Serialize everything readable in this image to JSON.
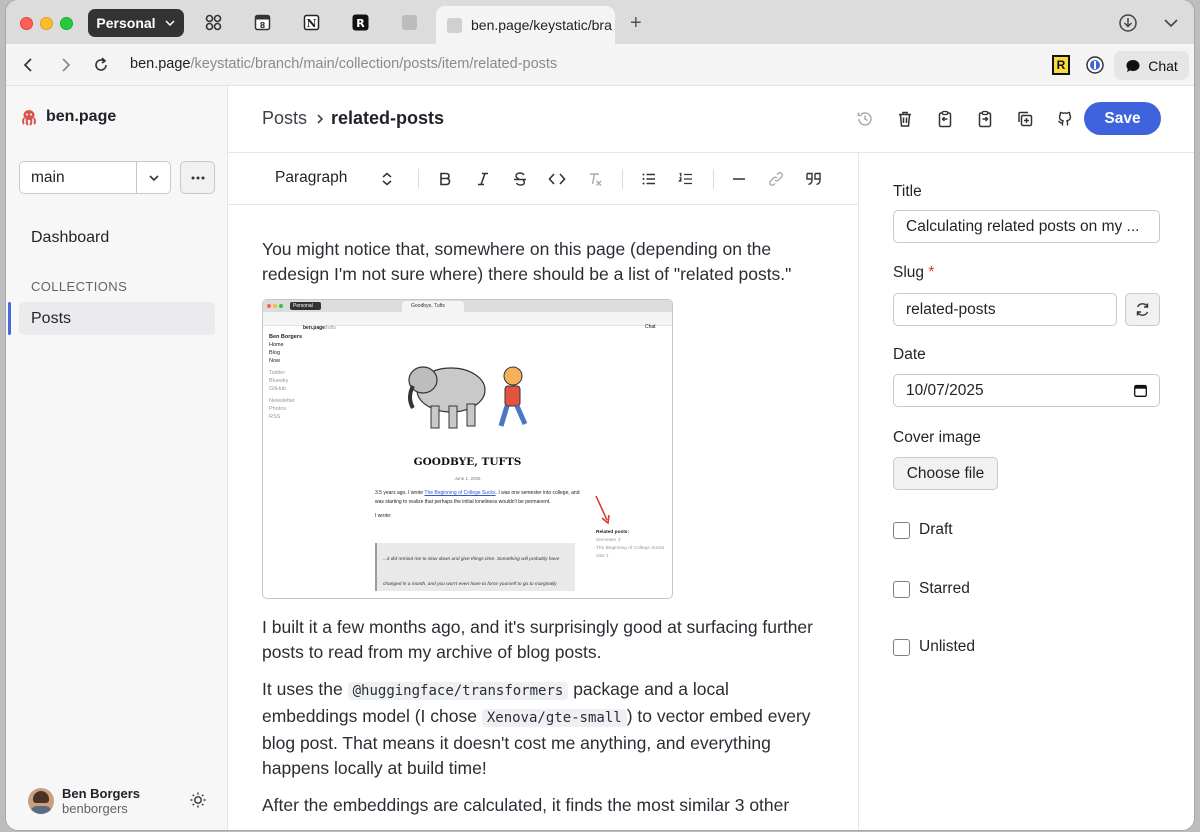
{
  "browser": {
    "profile": "Personal",
    "active_tab": "ben.page/keystatic/bra",
    "url_host": "ben.page",
    "url_path": "/keystatic/branch/main/collection/posts/item/related-posts",
    "chat_label": "Chat",
    "ext_label": "R"
  },
  "sidebar": {
    "brand": "ben.page",
    "branch": "main",
    "dashboard": "Dashboard",
    "section": "COLLECTIONS",
    "posts": "Posts",
    "user_name": "Ben Borgers",
    "user_handle": "benborgers"
  },
  "header": {
    "crumb_parent": "Posts",
    "crumb_current": "related-posts",
    "save": "Save"
  },
  "toolbar": {
    "block_type": "Paragraph"
  },
  "content": {
    "p1": "You might notice that, somewhere on this page (depending on the redesign I'm not sure where) there should be a list of \"related posts.\"",
    "p2": "I built it a few months ago, and it's surprisingly good at surfacing further posts to read from my archive of blog posts.",
    "p3_a": "It uses the ",
    "p3_code1": "@huggingface/transformers",
    "p3_b": " package and a local embeddings model (I chose ",
    "p3_code2": "Xenova/gte-small",
    "p3_c": ") to vector embed every blog post. That means it doesn't cost me anything, and everything happens locally at build time!",
    "p4": "After the embeddings are calculated, it finds the most similar 3 other"
  },
  "screenshot": {
    "profile": "Personal",
    "tab": "Goodbye, Tufts",
    "url_host": "ben.page",
    "url_path": "/tufts",
    "chat": "Chat",
    "side_title": "Ben Borgers",
    "side_links": [
      "Home",
      "Blog",
      "Now"
    ],
    "side_social": [
      "Twitter",
      "Bluesky",
      "GitHub"
    ],
    "side_more": [
      "Newsletter",
      "Photos",
      "RSS"
    ],
    "title": "GOODBYE, TUFTS",
    "date": "June 1, 2025",
    "body_a": "3.5 years ago, I wrote ",
    "body_link": "The Beginning of College Sucks",
    "body_b": ". I was one semester into college, and was starting to realize that perhaps the initial loneliness wouldn't be permanent.",
    "wrote": "I wrote:",
    "quote": "...it did remind me to slow down and give things time. Something will probably have changed in a month, and you won't even have to force yourself to go to marginally interesting club meetings or strike up tedious conversations with the people who sit next to you in class.",
    "related_title": "Related posts:",
    "related": [
      "Semester 3",
      "The Beginning of College Sucks",
      "vibe 1"
    ]
  },
  "fields": {
    "title_label": "Title",
    "title_value": "Calculating related posts on my ...",
    "slug_label": "Slug",
    "slug_required": "*",
    "slug_value": "related-posts",
    "date_label": "Date",
    "date_value": "10/07/2025",
    "cover_label": "Cover image",
    "choose_file": "Choose file",
    "draft": "Draft",
    "starred": "Starred",
    "unlisted": "Unlisted"
  },
  "colors": {
    "accent": "#3e63dd",
    "required": "#d13b2f"
  }
}
